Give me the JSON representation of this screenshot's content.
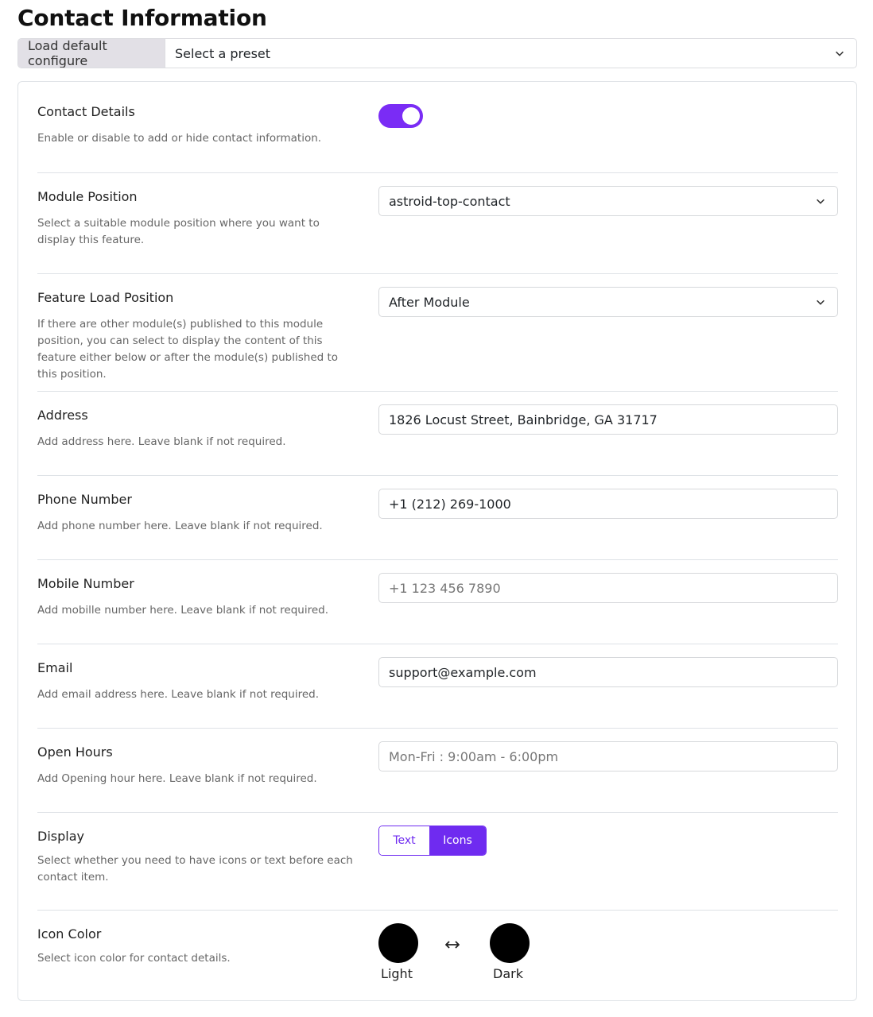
{
  "page": {
    "title": "Contact Information"
  },
  "preset": {
    "label": "Load default configure",
    "select_text": "Select a preset"
  },
  "fields": {
    "contact_details": {
      "label": "Contact Details",
      "desc": "Enable or disable to add or hide contact information.",
      "enabled": true
    },
    "module_position": {
      "label": "Module Position",
      "desc": "Select a suitable module position where you want to display this feature.",
      "value": "astroid-top-contact"
    },
    "feature_load_position": {
      "label": "Feature Load Position",
      "desc": "If there are other module(s) published to this module position, you can select to display the content of this feature either below or after the module(s) published to this position.",
      "value": "After Module"
    },
    "address": {
      "label": "Address",
      "desc": "Add address here. Leave blank if not required.",
      "value": "1826 Locust Street, Bainbridge, GA 31717"
    },
    "phone": {
      "label": "Phone Number",
      "desc": "Add phone number here. Leave blank if not required.",
      "value": "+1 (212) 269-1000"
    },
    "mobile": {
      "label": "Mobile Number",
      "desc": "Add mobille number here. Leave blank if not required.",
      "placeholder": "+1 123 456 7890"
    },
    "email": {
      "label": "Email",
      "desc": "Add email address here. Leave blank if not required.",
      "value": "support@example.com"
    },
    "open_hours": {
      "label": "Open Hours",
      "desc": "Add Opening hour here. Leave blank if not required.",
      "placeholder": "Mon-Fri : 9:00am - 6:00pm"
    },
    "display": {
      "label": "Display",
      "desc": "Select whether you need to have icons or text before each contact item.",
      "options": [
        "Text",
        "Icons"
      ],
      "selected": "Icons"
    },
    "icon_color": {
      "label": "Icon Color",
      "desc": "Select icon color for contact details.",
      "light_label": "Light",
      "dark_label": "Dark",
      "light_color": "#000000",
      "dark_color": "#000000"
    }
  },
  "colors": {
    "accent": "#6f2bf0",
    "toggle_on": "#7a2cf5"
  }
}
